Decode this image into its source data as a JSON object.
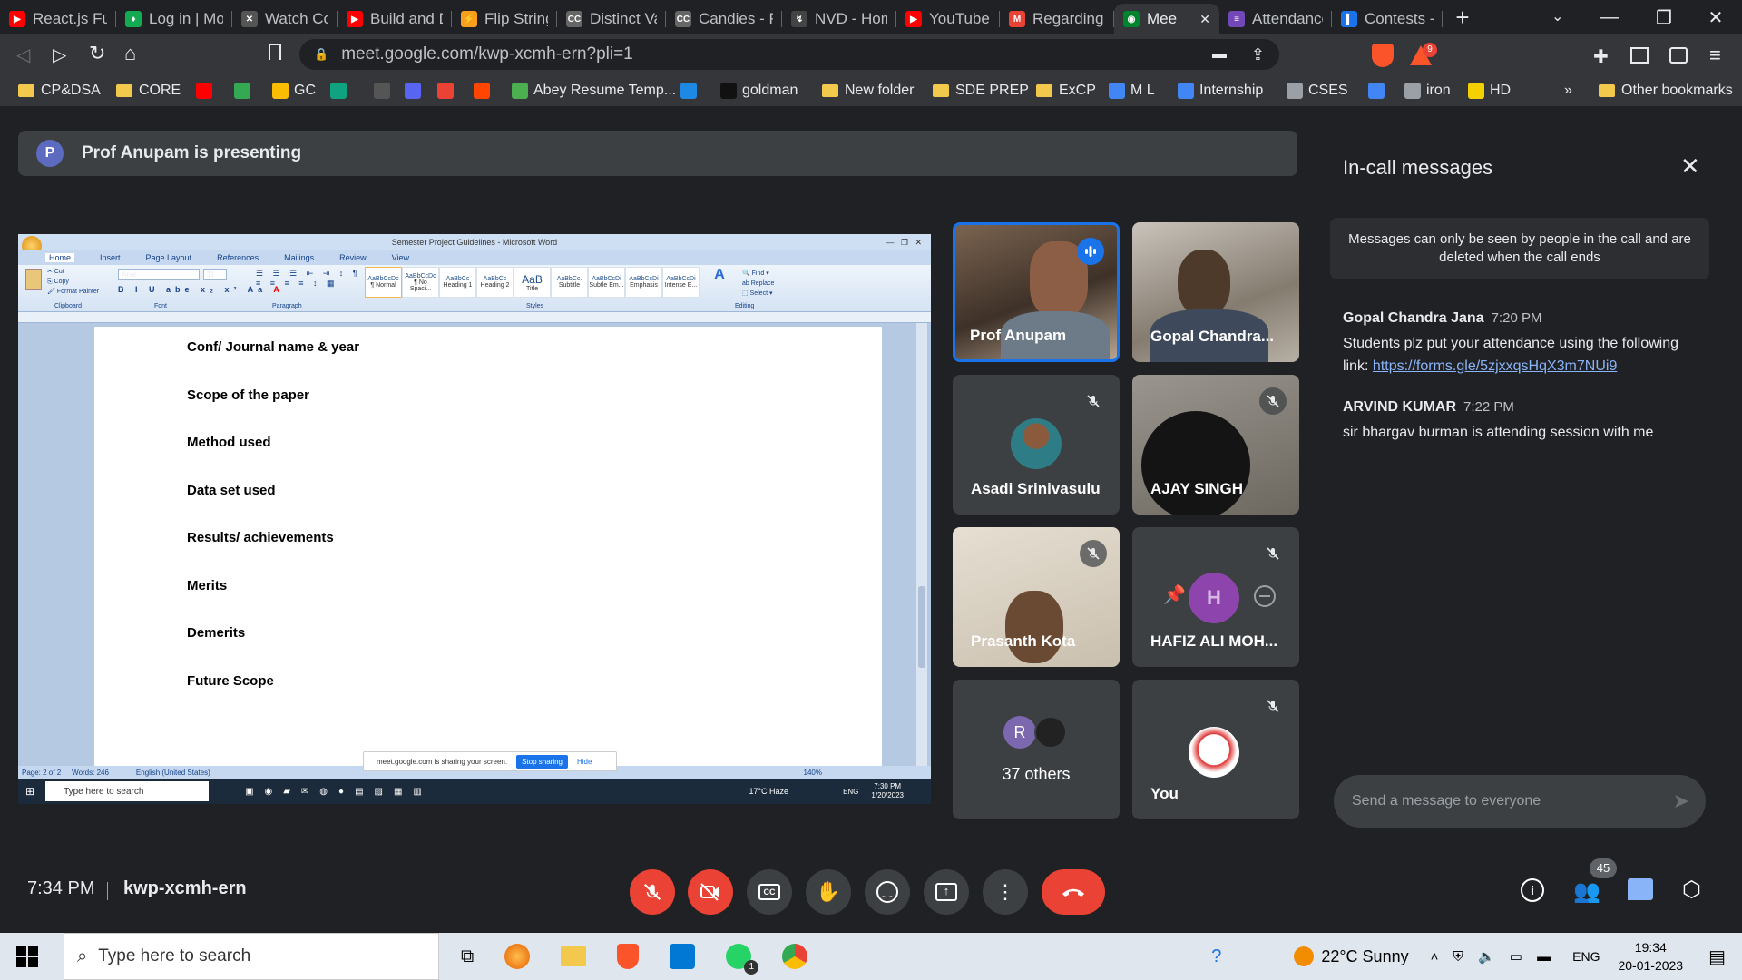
{
  "browser": {
    "tabs": [
      {
        "title": "React.js Full",
        "fav_color": "#ff0000",
        "fav_text": "▶"
      },
      {
        "title": "Log in | Mo",
        "fav_color": "#13aa52",
        "fav_text": "♦"
      },
      {
        "title": "Watch Code",
        "fav_color": "#555555",
        "fav_text": "✕"
      },
      {
        "title": "Build and D",
        "fav_color": "#ff0000",
        "fav_text": "▶"
      },
      {
        "title": "Flip String t",
        "fav_color": "#f89f1b",
        "fav_text": "⚡"
      },
      {
        "title": "Distinct Val",
        "fav_color": "#666666",
        "fav_text": "CC"
      },
      {
        "title": "Candies - P",
        "fav_color": "#666666",
        "fav_text": "CC"
      },
      {
        "title": "NVD - Hom",
        "fav_color": "#444444",
        "fav_text": "↯"
      },
      {
        "title": "YouTube",
        "fav_color": "#ff0000",
        "fav_text": "▶"
      },
      {
        "title": "Regarding",
        "fav_color": "#ea4335",
        "fav_text": "M"
      },
      {
        "title": "Mee",
        "fav_color": "#00832d",
        "fav_text": "◉"
      },
      {
        "title": "Attendance",
        "fav_color": "#7248b9",
        "fav_text": "≡"
      },
      {
        "title": "Contests - C",
        "fav_color": "#1a73e8",
        "fav_text": "▌"
      }
    ],
    "url": "meet.google.com/kwp-xcmh-ern?pli=1",
    "brave_badge": "9",
    "bookmarks": [
      {
        "label": "CP&DSA",
        "type": "folder"
      },
      {
        "label": "CORE",
        "type": "folder"
      },
      {
        "label": "",
        "type": "icon",
        "color": "#ff0000"
      },
      {
        "label": "",
        "type": "icon",
        "color": "#34a853"
      },
      {
        "label": "GC",
        "type": "icon",
        "color": "#fbbc04"
      },
      {
        "label": "",
        "type": "icon",
        "color": "#10a37f"
      },
      {
        "label": "",
        "type": "icon",
        "color": "#555555"
      },
      {
        "label": "",
        "type": "icon",
        "color": "#5865f2"
      },
      {
        "label": "",
        "type": "icon",
        "color": "#ea4335"
      },
      {
        "label": "",
        "type": "icon",
        "color": "#ff4500"
      },
      {
        "label": "Abey Resume Temp...",
        "type": "icon",
        "color": "#4caf50"
      },
      {
        "label": "",
        "type": "icon",
        "color": "#1e88e5"
      },
      {
        "label": "goldman",
        "type": "icon",
        "color": "#111111"
      },
      {
        "label": "New folder",
        "type": "folder"
      },
      {
        "label": "SDE PREP",
        "type": "folder"
      },
      {
        "label": "ExCP",
        "type": "folder"
      },
      {
        "label": "M L",
        "type": "icon",
        "color": "#4285f4"
      },
      {
        "label": "Internship",
        "type": "icon",
        "color": "#4285f4"
      },
      {
        "label": "CSES",
        "type": "icon",
        "color": "#9aa0a6"
      },
      {
        "label": "",
        "type": "icon",
        "color": "#4285f4"
      },
      {
        "label": "iron",
        "type": "icon",
        "color": "#9aa0a6"
      },
      {
        "label": "HD",
        "type": "icon",
        "color": "#f5d000"
      }
    ],
    "other_bookmarks": "Other bookmarks"
  },
  "meet": {
    "presenting_initial": "P",
    "presenting_text": "Prof Anupam is presenting",
    "word": {
      "window_title": "Semester Project Guidelines - Microsoft Word",
      "ribbon_tabs": [
        "Home",
        "Insert",
        "Page Layout",
        "References",
        "Mailings",
        "Review",
        "View"
      ],
      "font_name": "Arial",
      "font_size": "11",
      "styles": [
        "¶ Normal",
        "¶ No Spaci...",
        "Heading 1",
        "Heading 2",
        "Title",
        "Subtitle",
        "Subtle Em...",
        "Emphasis",
        "Intense E..."
      ],
      "style_previews": [
        "AaBbCcDc",
        "AaBbCcDc",
        "AaBbCc",
        "AaBbCc",
        "AaB",
        "AaBbCc.",
        "AaBbCcDi",
        "AaBbCcDi",
        "AaBbCcDi"
      ],
      "group_labels": [
        "Clipboard",
        "Font",
        "Paragraph",
        "Styles",
        "Editing"
      ],
      "doc_lines": [
        "Conf/ Journal name & year",
        "Scope of the paper",
        "Method used",
        "Data set used",
        "Results/ achievements",
        "Merits",
        "Demerits",
        "Future Scope"
      ],
      "status_page": "Page: 2 of 2",
      "status_words": "Words: 246",
      "status_lang": "English (United States)",
      "zoom": "140%",
      "share_text": "meet.google.com is sharing your screen.",
      "stop_sharing": "Stop sharing",
      "hide": "Hide",
      "task_search": "Type here to search",
      "task_weather": "17°C  Haze",
      "task_lang": "ENG",
      "task_time": "7:30 PM",
      "task_date": "1/20/2023"
    },
    "tiles": [
      {
        "name": "Prof Anupam"
      },
      {
        "name": "Gopal Chandra..."
      },
      {
        "name": "Asadi Srinivasulu"
      },
      {
        "name": "AJAY SINGH"
      },
      {
        "name": "Prasanth Kota"
      },
      {
        "name": "HAFIZ ALI MOH..."
      },
      {
        "name": "37 others",
        "initial": "R"
      },
      {
        "name": "You"
      }
    ],
    "time": "7:34 PM",
    "meeting_code": "kwp-xcmh-ern",
    "people_count": "45"
  },
  "chat": {
    "title": "In-call messages",
    "notice": "Messages can only be seen by people in the call and are deleted when the call ends",
    "messages": [
      {
        "sender": "Gopal Chandra Jana",
        "time": "7:20 PM",
        "text": "Students plz put your attendance using the following link: ",
        "link": "https://forms.gle/5zjxxqsHqX3m7NUi9"
      },
      {
        "sender": "ARVIND KUMAR",
        "time": "7:22 PM",
        "text": "sir bhargav burman is attending session with me",
        "link": ""
      }
    ],
    "input_placeholder": "Send a message to everyone"
  },
  "taskbar": {
    "search": "Type here to search",
    "weather": "22°C  Sunny",
    "lang": "ENG",
    "time": "19:34",
    "date": "20-01-2023",
    "badge": "1"
  }
}
